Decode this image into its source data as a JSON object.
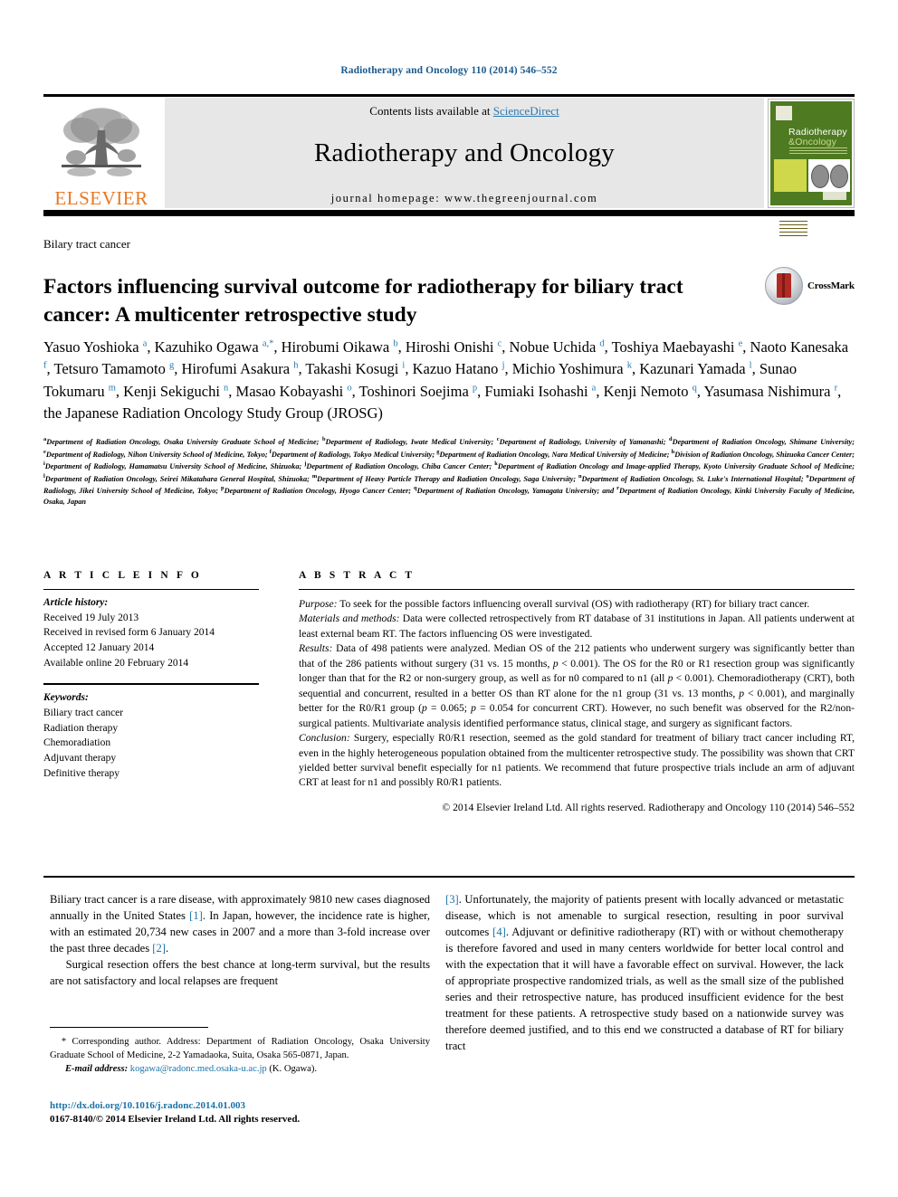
{
  "running_head": "Radiotherapy and Oncology 110 (2014) 546–552",
  "masthead": {
    "contents_prefix": "Contents lists available at ",
    "sciencedirect": "ScienceDirect",
    "journal_name": "Radiotherapy and Oncology",
    "homepage": "journal homepage: www.thegreenjournal.com",
    "publisher": "ELSEVIER",
    "cover": {
      "title_line1": "Radiotherapy",
      "title_line2": "&Oncology"
    }
  },
  "section_label": "Bilary tract cancer",
  "title": "Factors influencing survival outcome for radiotherapy for biliary tract cancer: A multicenter retrospective study",
  "crossmark_label": "CrossMark",
  "authors_html": "Yasuo Yoshioka <sup>a</sup>, Kazuhiko Ogawa <sup>a,<span class=\"corr\">*</span></sup>, Hirobumi Oikawa <sup>b</sup>, Hiroshi Onishi <sup>c</sup>, Nobue Uchida <sup>d</sup>, Toshiya Maebayashi <sup>e</sup>, Naoto Kanesaka <sup>f</sup>, Tetsuro Tamamoto <sup>g</sup>, Hirofumi Asakura <sup>h</sup>, Takashi Kosugi <sup>i</sup>, Kazuo Hatano <sup>j</sup>, Michio Yoshimura <sup>k</sup>, Kazunari Yamada <sup>l</sup>, Sunao Tokumaru <sup>m</sup>, Kenji Sekiguchi <sup>n</sup>, Masao Kobayashi <sup>o</sup>, Toshinori Soejima <sup>p</sup>, Fumiaki Isohashi <sup>a</sup>, Kenji Nemoto <sup>q</sup>, Yasumasa Nishimura <sup>r</sup>, the Japanese Radiation Oncology Study Group (JROSG)",
  "affiliations_html": "<sup>a</sup>Department of Radiation Oncology, Osaka University Graduate School of Medicine; <sup>b</sup>Department of Radiology, Iwate Medical University; <sup>c</sup>Department of Radiology, University of Yamanashi; <sup>d</sup>Department of Radiation Oncology, Shimane University; <sup>e</sup>Department of Radiology, Nihon University School of Medicine, Tokyo; <sup>f</sup>Department of Radiology, Tokyo Medical University; <sup>g</sup>Department of Radiation Oncology, Nara Medical University of Medicine; <sup>h</sup>Division of Radiation Oncology, Shizuoka Cancer Center; <sup>i</sup>Department of Radiology, Hamamatsu University School of Medicine, Shizuoka; <sup>j</sup>Department of Radiation Oncology, Chiba Cancer Center; <sup>k</sup>Department of Radiation Oncology and Image-applied Therapy, Kyoto University Graduate School of Medicine; <sup>l</sup>Department of Radiation Oncology, Seirei Mikatahara General Hospital, Shizuoka; <sup>m</sup>Department of Heavy Particle Therapy and Radiation Oncology, Saga University; <sup>n</sup>Department of Radiation Oncology, St. Luke's International Hospital; <sup>o</sup>Department of Radiology, Jikei University School of Medicine, Tokyo; <sup>p</sup>Department of Radiation Oncology, Hyogo Cancer Center; <sup>q</sup>Department of Radiation Oncology, Yamagata University; and <sup>r</sup>Department of Radiation Oncology, Kinki University Faculty of Medicine, Osaka, Japan",
  "article_info": {
    "heading": "A R T I C L E  I N F O",
    "history_label": "Article history:",
    "history": [
      "Received 19 July 2013",
      "Received in revised form 6 January 2014",
      "Accepted 12 January 2014",
      "Available online 20 February 2014"
    ],
    "keywords_label": "Keywords:",
    "keywords": [
      "Biliary tract cancer",
      "Radiation therapy",
      "Chemoradiation",
      "Adjuvant therapy",
      "Definitive therapy"
    ]
  },
  "abstract": {
    "heading": "A B S T R A C T",
    "sections_html": "<p style=\"margin:0\"><em>Purpose:</em> To seek for the possible factors influencing overall survival (OS) with radiotherapy (RT) for biliary tract cancer.</p><p style=\"margin:0\"><em>Materials and methods:</em> Data were collected retrospectively from RT database of 31 institutions in Japan. All patients underwent at least external beam RT. The factors influencing OS were investigated.</p><p style=\"margin:0\"><em>Results:</em> Data of 498 patients were analyzed. Median OS of the 212 patients who underwent surgery was significantly better than that of the 286 patients without surgery (31 vs. 15 months, <em>p</em> &lt; 0.001). The OS for the R0 or R1 resection group was significantly longer than that for the R2 or non-surgery group, as well as for n0 compared to n1 (all <em>p</em> &lt; 0.001). Chemoradiotherapy (CRT), both sequential and concurrent, resulted in a better OS than RT alone for the n1 group (31 vs. 13 months, <em>p</em> &lt; 0.001), and marginally better for the R0/R1 group (<em>p</em> = 0.065; <em>p</em> = 0.054 for concurrent CRT). However, no such benefit was observed for the R2/non-surgical patients. Multivariate analysis identified performance status, clinical stage, and surgery as significant factors.</p><p style=\"margin:0\"><em>Conclusion:</em> Surgery, especially R0/R1 resection, seemed as the gold standard for treatment of biliary tract cancer including RT, even in the highly heterogeneous population obtained from the multicenter retrospective study. The possibility was shown that CRT yielded better survival benefit especially for n1 patients. We recommend that future prospective trials include an arm of adjuvant CRT at least for n1 and possibly R0/R1 patients.</p>",
    "copyright": "© 2014 Elsevier Ireland Ltd. All rights reserved. Radiotherapy and Oncology 110 (2014) 546–552"
  },
  "body": {
    "left_html": "<p>Biliary tract cancer is a rare disease, with approximately 9810 new cases diagnosed annually in the United States <span class=\"ref\">[1]</span>. In Japan, however, the incidence rate is higher, with an estimated 20,734 new cases in 2007 and a more than 3-fold increase over the past three decades <span class=\"ref\">[2]</span>.</p><p>Surgical resection offers the best chance at long-term survival, but the results are not satisfactory and local relapses are frequent</p>",
    "right_html": "<p><span class=\"ref\">[3]</span>. Unfortunately, the majority of patients present with locally advanced or metastatic disease, which is not amenable to surgical resection, resulting in poor survival outcomes <span class=\"ref\">[4]</span>. Adjuvant or definitive radiotherapy (RT) with or without chemotherapy is therefore favored and used in many centers worldwide for better local control and with the expectation that it will have a favorable effect on survival. However, the lack of appropriate prospective randomized trials, as well as the small size of the published series and their retrospective nature, has produced insufficient evidence for the best treatment for these patients. A retrospective study based on a nationwide survey was therefore deemed justified, and to this end we constructed a database of RT for biliary tract</p>"
  },
  "footnote_html": "&nbsp;&nbsp;* Corresponding author. Address: Department of Radiation Oncology, Osaka University Graduate School of Medicine, 2-2 Yamadaoka, Suita, Osaka 565-0871, Japan.<br><span style=\"display:inline-block;width:1.6em\"></span><span class=\"ital\">E-mail address:</span> <span class=\"mail\">kogawa@radonc.med.osaka-u.ac.jp</span> (K. Ogawa).",
  "doi": "http://dx.doi.org/10.1016/j.radonc.2014.01.003",
  "issn": "0167-8140/© 2014 Elsevier Ireland Ltd. All rights reserved.",
  "colors": {
    "link": "#1a73a8",
    "sciencedirect": "#2a7ab0",
    "elsevier_orange": "#E87722",
    "cover_green": "#4e7a21"
  }
}
